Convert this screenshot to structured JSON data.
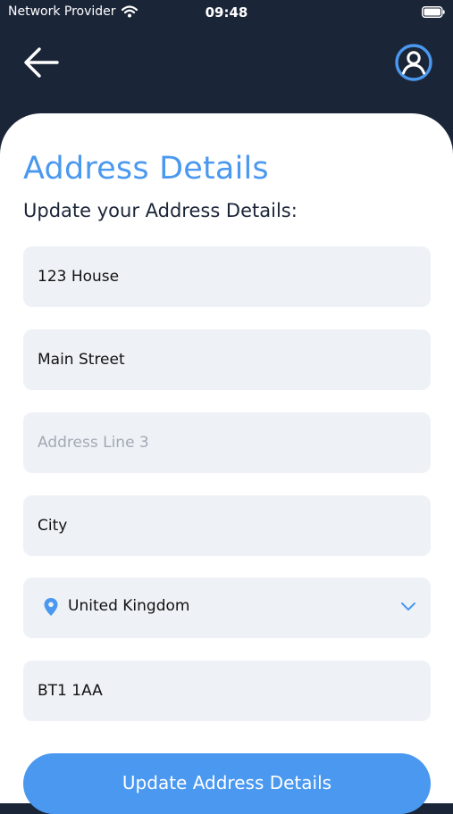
{
  "status_bar": {
    "carrier": "Network Provider",
    "time": "09:48"
  },
  "header": {
    "back_icon": "arrow-left-icon",
    "profile_icon": "user-circle-icon"
  },
  "form": {
    "title": "Address Details",
    "subtitle": "Update your Address Details:",
    "fields": [
      {
        "value": "123 House",
        "placeholder": ""
      },
      {
        "value": "Main Street",
        "placeholder": ""
      },
      {
        "value": "",
        "placeholder": "Address Line 3"
      },
      {
        "value": "City",
        "placeholder": ""
      }
    ],
    "country": {
      "value": "United Kingdom",
      "icon": "location-pin-icon",
      "dropdown_icon": "chevron-down-icon"
    },
    "postcode": {
      "value": "BT1 1AA",
      "placeholder": ""
    },
    "submit_label": "Update Address Details"
  },
  "colors": {
    "header_bg": "#1b2538",
    "accent": "#4a98ef",
    "field_bg": "#eef2f7"
  }
}
